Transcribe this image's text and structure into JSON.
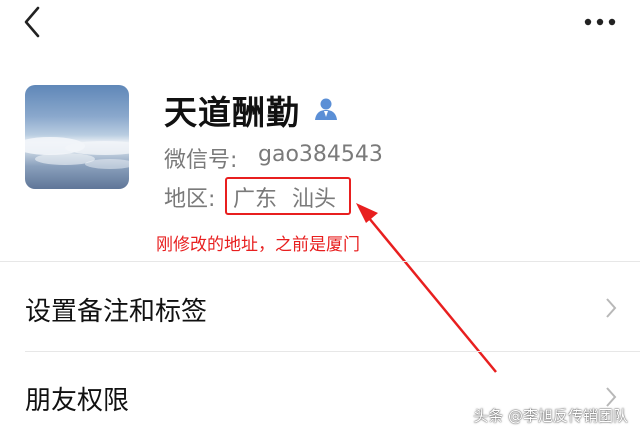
{
  "profile": {
    "name": "天道酬勤",
    "wechat_id_label": "微信号:",
    "wechat_id_value": "gao384543",
    "region_label": "地区:",
    "region_province": "广东",
    "region_city": "汕头"
  },
  "annotation": {
    "text": "刚修改的地址，之前是厦门",
    "color": "#e81f1f"
  },
  "menu": {
    "items": [
      {
        "label": "设置备注和标签"
      },
      {
        "label": "朋友权限"
      }
    ]
  },
  "watermark": {
    "text": "头条 @李旭反传销团队"
  },
  "icons": {
    "back": "chevron-left-icon",
    "more": "more-dots-icon",
    "contact": "contact-person-icon",
    "row_chevron": "chevron-right-icon"
  },
  "colors": {
    "accent_red": "#e81f1f",
    "contact_icon_blue": "#5b8fd6",
    "secondary_text": "#7a7a7a"
  }
}
